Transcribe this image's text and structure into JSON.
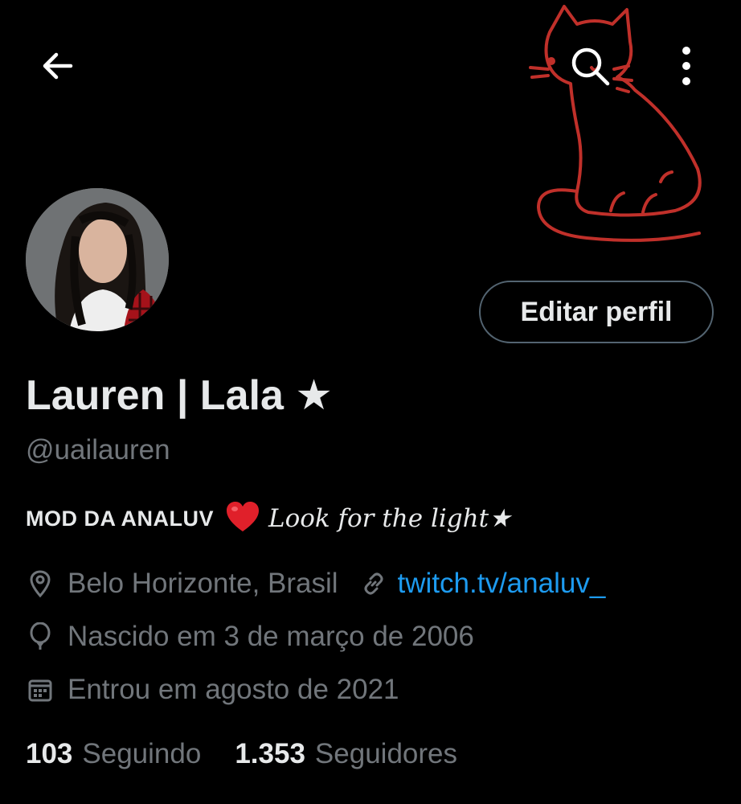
{
  "header": {
    "back_icon": "arrow-left-icon",
    "search_icon": "search-icon",
    "more_icon": "more-vertical-icon"
  },
  "profile": {
    "display_name": "Lauren | Lala ★",
    "handle": "@uailauren",
    "edit_button_label": "Editar perfil",
    "bio": {
      "prefix": "MOD DA ANALUV",
      "emoji": "heart-icon",
      "motto": "Look for the light★"
    },
    "location": "Belo Horizonte, Brasil",
    "link": "twitch.tv/analuv_",
    "birth": "Nascido em 3 de março de 2006",
    "joined": "Entrou em agosto de 2021",
    "following_count": "103",
    "following_label": "Seguindo",
    "followers_count": "1.353",
    "followers_label": "Seguidores"
  },
  "colors": {
    "background": "#000000",
    "text_primary": "#e7e9ea",
    "text_secondary": "#71767b",
    "link": "#1d9bf0",
    "border": "#536471",
    "banner_cat": "#c0302a",
    "heart": "#e0202a"
  }
}
